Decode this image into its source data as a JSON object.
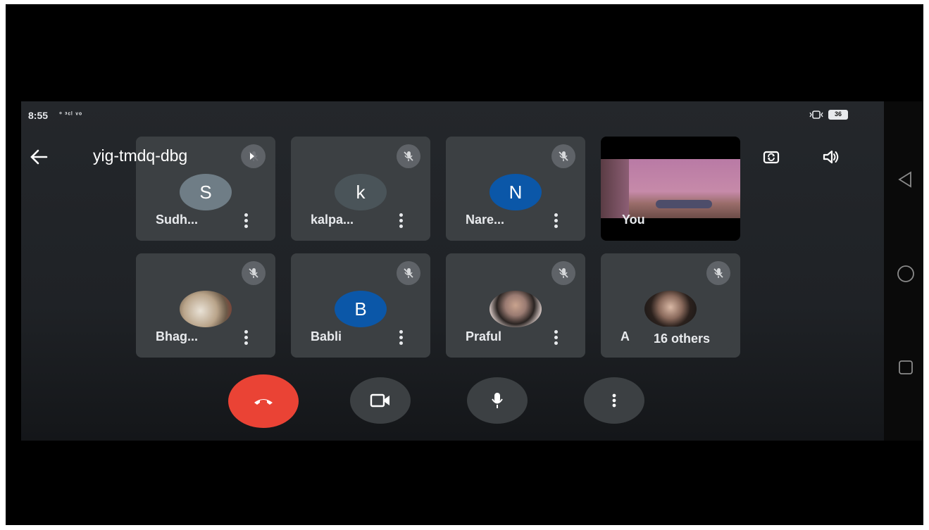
{
  "status_bar": {
    "time": "8:55",
    "signal_text": "° ³ᶜˡ ᵛᵒ",
    "battery": "36"
  },
  "header": {
    "meeting_code": "yig-tmdq-dbg"
  },
  "participants": [
    {
      "name": "Sudh...",
      "initial": "S",
      "avatar_color": "#6f7d86",
      "muted": true,
      "photo": false
    },
    {
      "name": "kalpa...",
      "initial": "k",
      "avatar_color": "#4a5459",
      "muted": true,
      "photo": false
    },
    {
      "name": "Nare...",
      "initial": "N",
      "avatar_color": "#0b57a8",
      "muted": true,
      "photo": false
    },
    {
      "name": "You",
      "self_view": true
    },
    {
      "name": "Bhag...",
      "initial": "",
      "avatar_color": "#b9a48a",
      "muted": true,
      "photo": true
    },
    {
      "name": "Babli",
      "initial": "B",
      "avatar_color": "#0b57a8",
      "muted": true,
      "photo": false
    },
    {
      "name": "Praful",
      "initial": "",
      "avatar_color": "#9a7b72",
      "muted": true,
      "photo": true
    },
    {
      "name": "Aa",
      "initial": "",
      "avatar_color": "#5a4036",
      "muted": true,
      "photo": true,
      "overflow_label": "16 others"
    }
  ],
  "controls": {
    "end_call_color": "#ea4335",
    "button_color": "#3c4043"
  },
  "icons": {
    "back": "arrow-left-icon",
    "present": "present-icon",
    "camera_switch": "camera-switch-icon",
    "speaker": "speaker-icon",
    "mic_off": "mic-off-icon",
    "end_call": "phone-hangup-icon",
    "camera": "camera-icon",
    "mic": "mic-icon",
    "more": "more-vert-icon",
    "nav_back": "triangle-back-icon",
    "nav_home": "circle-home-icon",
    "nav_recent": "square-recent-icon"
  }
}
